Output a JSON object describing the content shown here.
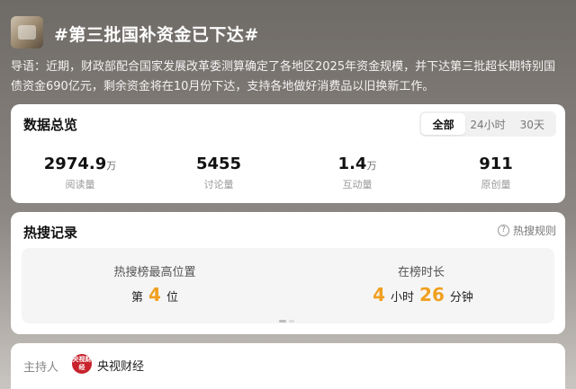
{
  "header": {
    "thumbnail_icon": "topic-thumbnail",
    "title": "#第三批国补资金已下达#"
  },
  "intro": {
    "text": "导语：近期，财政部配合国家发展改革委测算确定了各地区2025年资金规模，并下达第三批超长期特别国债资金690亿元，剩余资金将在10月份下达，支持各地做好消费品以旧换新工作。"
  },
  "overview": {
    "title": "数据总览",
    "tabs": [
      {
        "label": "全部",
        "active": true
      },
      {
        "label": "24小时",
        "active": false
      },
      {
        "label": "30天",
        "active": false
      }
    ],
    "stats": [
      {
        "value": "2974.9",
        "unit": "万",
        "label": "阅读量"
      },
      {
        "value": "5455",
        "unit": "",
        "label": "讨论量"
      },
      {
        "value": "1.4",
        "unit": "万",
        "label": "互动量"
      },
      {
        "value": "911",
        "unit": "",
        "label": "原创量"
      }
    ]
  },
  "records": {
    "title": "热搜记录",
    "rules_label": "热搜规则",
    "rules_icon": "question-circle-icon",
    "peak": {
      "label": "热搜榜最高位置",
      "prefix": "第",
      "value": "4",
      "suffix": "位"
    },
    "duration": {
      "label": "在榜时长",
      "hours": "4",
      "hours_unit": "小时",
      "minutes": "26",
      "minutes_unit": "分钟"
    },
    "accent_color": "#f0a020"
  },
  "host": {
    "label": "主持人",
    "avatar_text": "央视财经",
    "name": "央视财经",
    "avatar_color": "#c8232c"
  }
}
